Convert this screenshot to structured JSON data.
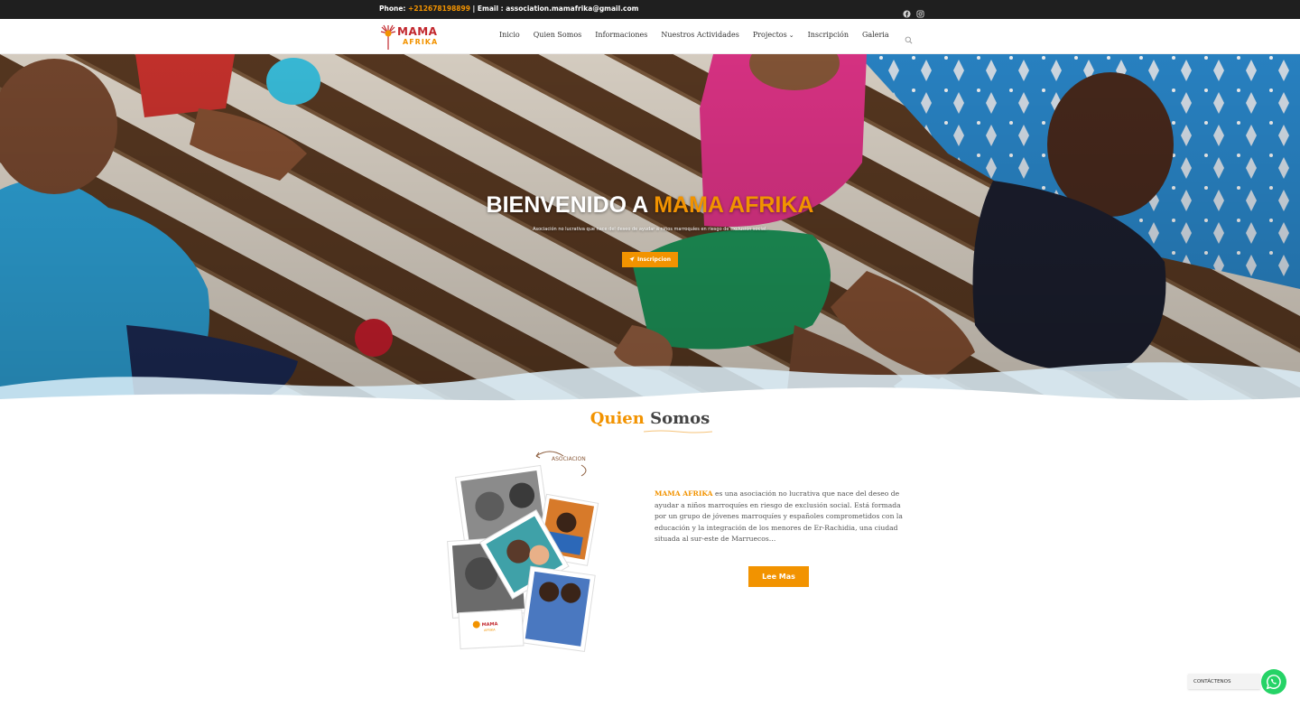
{
  "topbar": {
    "phone_label": "Phone: ",
    "phone_value": "+212678198899",
    "separator": " | Email : ",
    "email": "association.mamafrika@gmail.com",
    "social": [
      "facebook-icon",
      "instagram-icon"
    ]
  },
  "nav": {
    "logo_top": "MAMA",
    "logo_bottom": "AFRIKA",
    "items": [
      {
        "label": "Inicio"
      },
      {
        "label": "Quien Somos"
      },
      {
        "label": "Informaciones"
      },
      {
        "label": "Nuestros Actividades"
      },
      {
        "label": "Projectos",
        "has_dropdown": true
      },
      {
        "label": "Inscripción"
      },
      {
        "label": "Galeria"
      }
    ],
    "search_icon": "search-icon"
  },
  "hero": {
    "title_part1": "BIENVENIDO A ",
    "title_part2": "MAMA AFRIKA",
    "subtitle": "Asociación no lucrativa que nace del deseo de ayudar a niños marroquíes en riesgo de exclusión social.",
    "cta_label": "Inscripcion",
    "cta_icon": "paper-plane-icon"
  },
  "about": {
    "title_part1": "Quien",
    "title_part2": " Somos",
    "collage_label": "ASOCIACION",
    "brand": "MAMA AFRIKA",
    "text": " es una asociación no lucrativa que nace del deseo de ayudar a niños marroquíes en riesgo de exclusión social. Está formada por un grupo de jóvenes marroquíes y españoles comprometidos con la educación y la integración de los menores de Er-Rachidia, una ciudad situada al sur-este de Marruecos…",
    "more_label": "Lee Mas"
  },
  "whatsapp": {
    "label": "CONTÁCTENOS",
    "icon": "whatsapp-icon"
  },
  "colors": {
    "accent": "#f29300",
    "dark": "#1f1f1f",
    "whatsapp": "#25d366"
  }
}
